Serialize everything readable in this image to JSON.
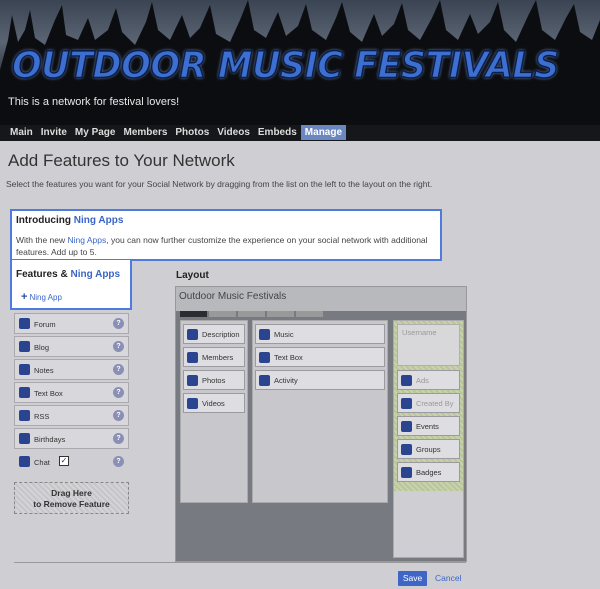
{
  "site": {
    "title": "OUTDOOR MUSIC FESTIVALS",
    "tagline": "This is a network for festival lovers!"
  },
  "nav": [
    "Main",
    "Invite",
    "My Page",
    "Members",
    "Photos",
    "Videos",
    "Embeds",
    "Manage"
  ],
  "nav_active": "Manage",
  "page": {
    "title": "Add Features to Your Network",
    "intro": "Select the features you want for your Social Network by dragging from the list on the left to the layout on the right."
  },
  "callout": {
    "title_prefix": "Introducing ",
    "title_link": "Ning Apps",
    "text_before": "With the new ",
    "text_link": "Ning Apps",
    "text_after": ", you can now further customize the experience on your social network with additional features. Add up to 5."
  },
  "features_box": {
    "title_prefix": "Features & ",
    "title_link": "Ning Apps",
    "add_label": "Ning App"
  },
  "features": [
    {
      "label": "Forum",
      "icon": "forum-icon"
    },
    {
      "label": "Blog",
      "icon": "blog-icon"
    },
    {
      "label": "Notes",
      "icon": "notes-icon"
    },
    {
      "label": "Text Box",
      "icon": "text-box-icon"
    },
    {
      "label": "RSS",
      "icon": "rss-icon"
    },
    {
      "label": "Birthdays",
      "icon": "birthdays-icon"
    },
    {
      "label": "Chat",
      "icon": "chat-icon"
    }
  ],
  "drop_zone": {
    "line1": "Drag Here",
    "line2": "to Remove Feature"
  },
  "layout": {
    "label": "Layout",
    "header": "Outdoor Music Festivals",
    "col1": [
      "Description",
      "Members",
      "Photos",
      "Videos"
    ],
    "col2": [
      "Music",
      "Text Box",
      "Activity"
    ],
    "col3_username": "Username",
    "col3": [
      "Ads",
      "Created By",
      "Events",
      "Groups",
      "Badges"
    ]
  },
  "actions": {
    "save": "Save",
    "cancel": "Cancel"
  },
  "colors": {
    "accent": "#3a65c8",
    "nav_active": "#6a87c2"
  }
}
